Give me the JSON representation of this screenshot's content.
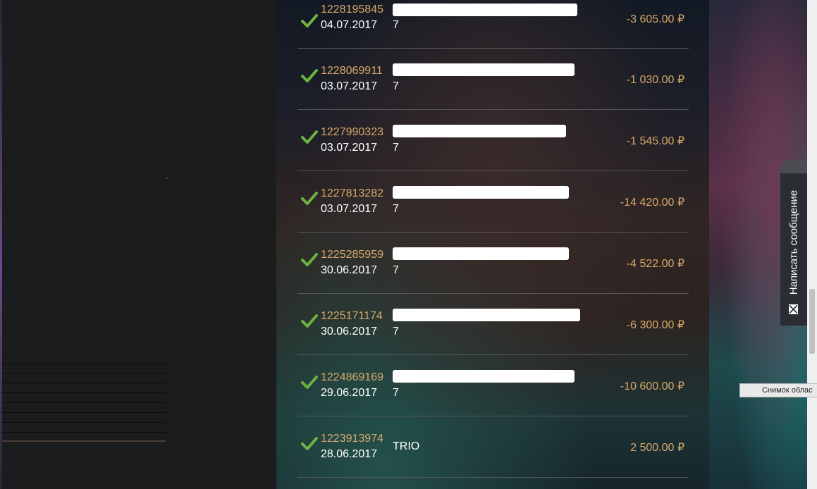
{
  "transactions": [
    {
      "id": "1228195845",
      "date": "04.07.2017",
      "description": "7",
      "amount": "-3 605.00 ₽"
    },
    {
      "id": "1228069911",
      "date": "03.07.2017",
      "description": "7",
      "amount": "-1 030.00 ₽"
    },
    {
      "id": "1227990323",
      "date": "03.07.2017",
      "description": "7",
      "amount": "-1 545.00 ₽"
    },
    {
      "id": "1227813282",
      "date": "03.07.2017",
      "description": "7",
      "amount": "-14 420.00 ₽"
    },
    {
      "id": "1225285959",
      "date": "30.06.2017",
      "description": "7",
      "amount": "-4 522.00 ₽"
    },
    {
      "id": "1225171174",
      "date": "30.06.2017",
      "description": "7",
      "amount": "-6 300.00 ₽"
    },
    {
      "id": "1224869169",
      "date": "29.06.2017",
      "description": "7",
      "amount": "-10 600.00 ₽"
    },
    {
      "id": "1223913974",
      "date": "28.06.2017",
      "description": "TRIO",
      "amount": "2 500.00 ₽"
    }
  ],
  "feedback_tab": {
    "label": "Написать сообщение",
    "icon": "envelope-icon"
  },
  "snip_tooltip": {
    "text": "Снимок облас"
  },
  "colors": {
    "accent": "#d7a86a",
    "check": "#6db33f",
    "text": "#ffffff"
  }
}
